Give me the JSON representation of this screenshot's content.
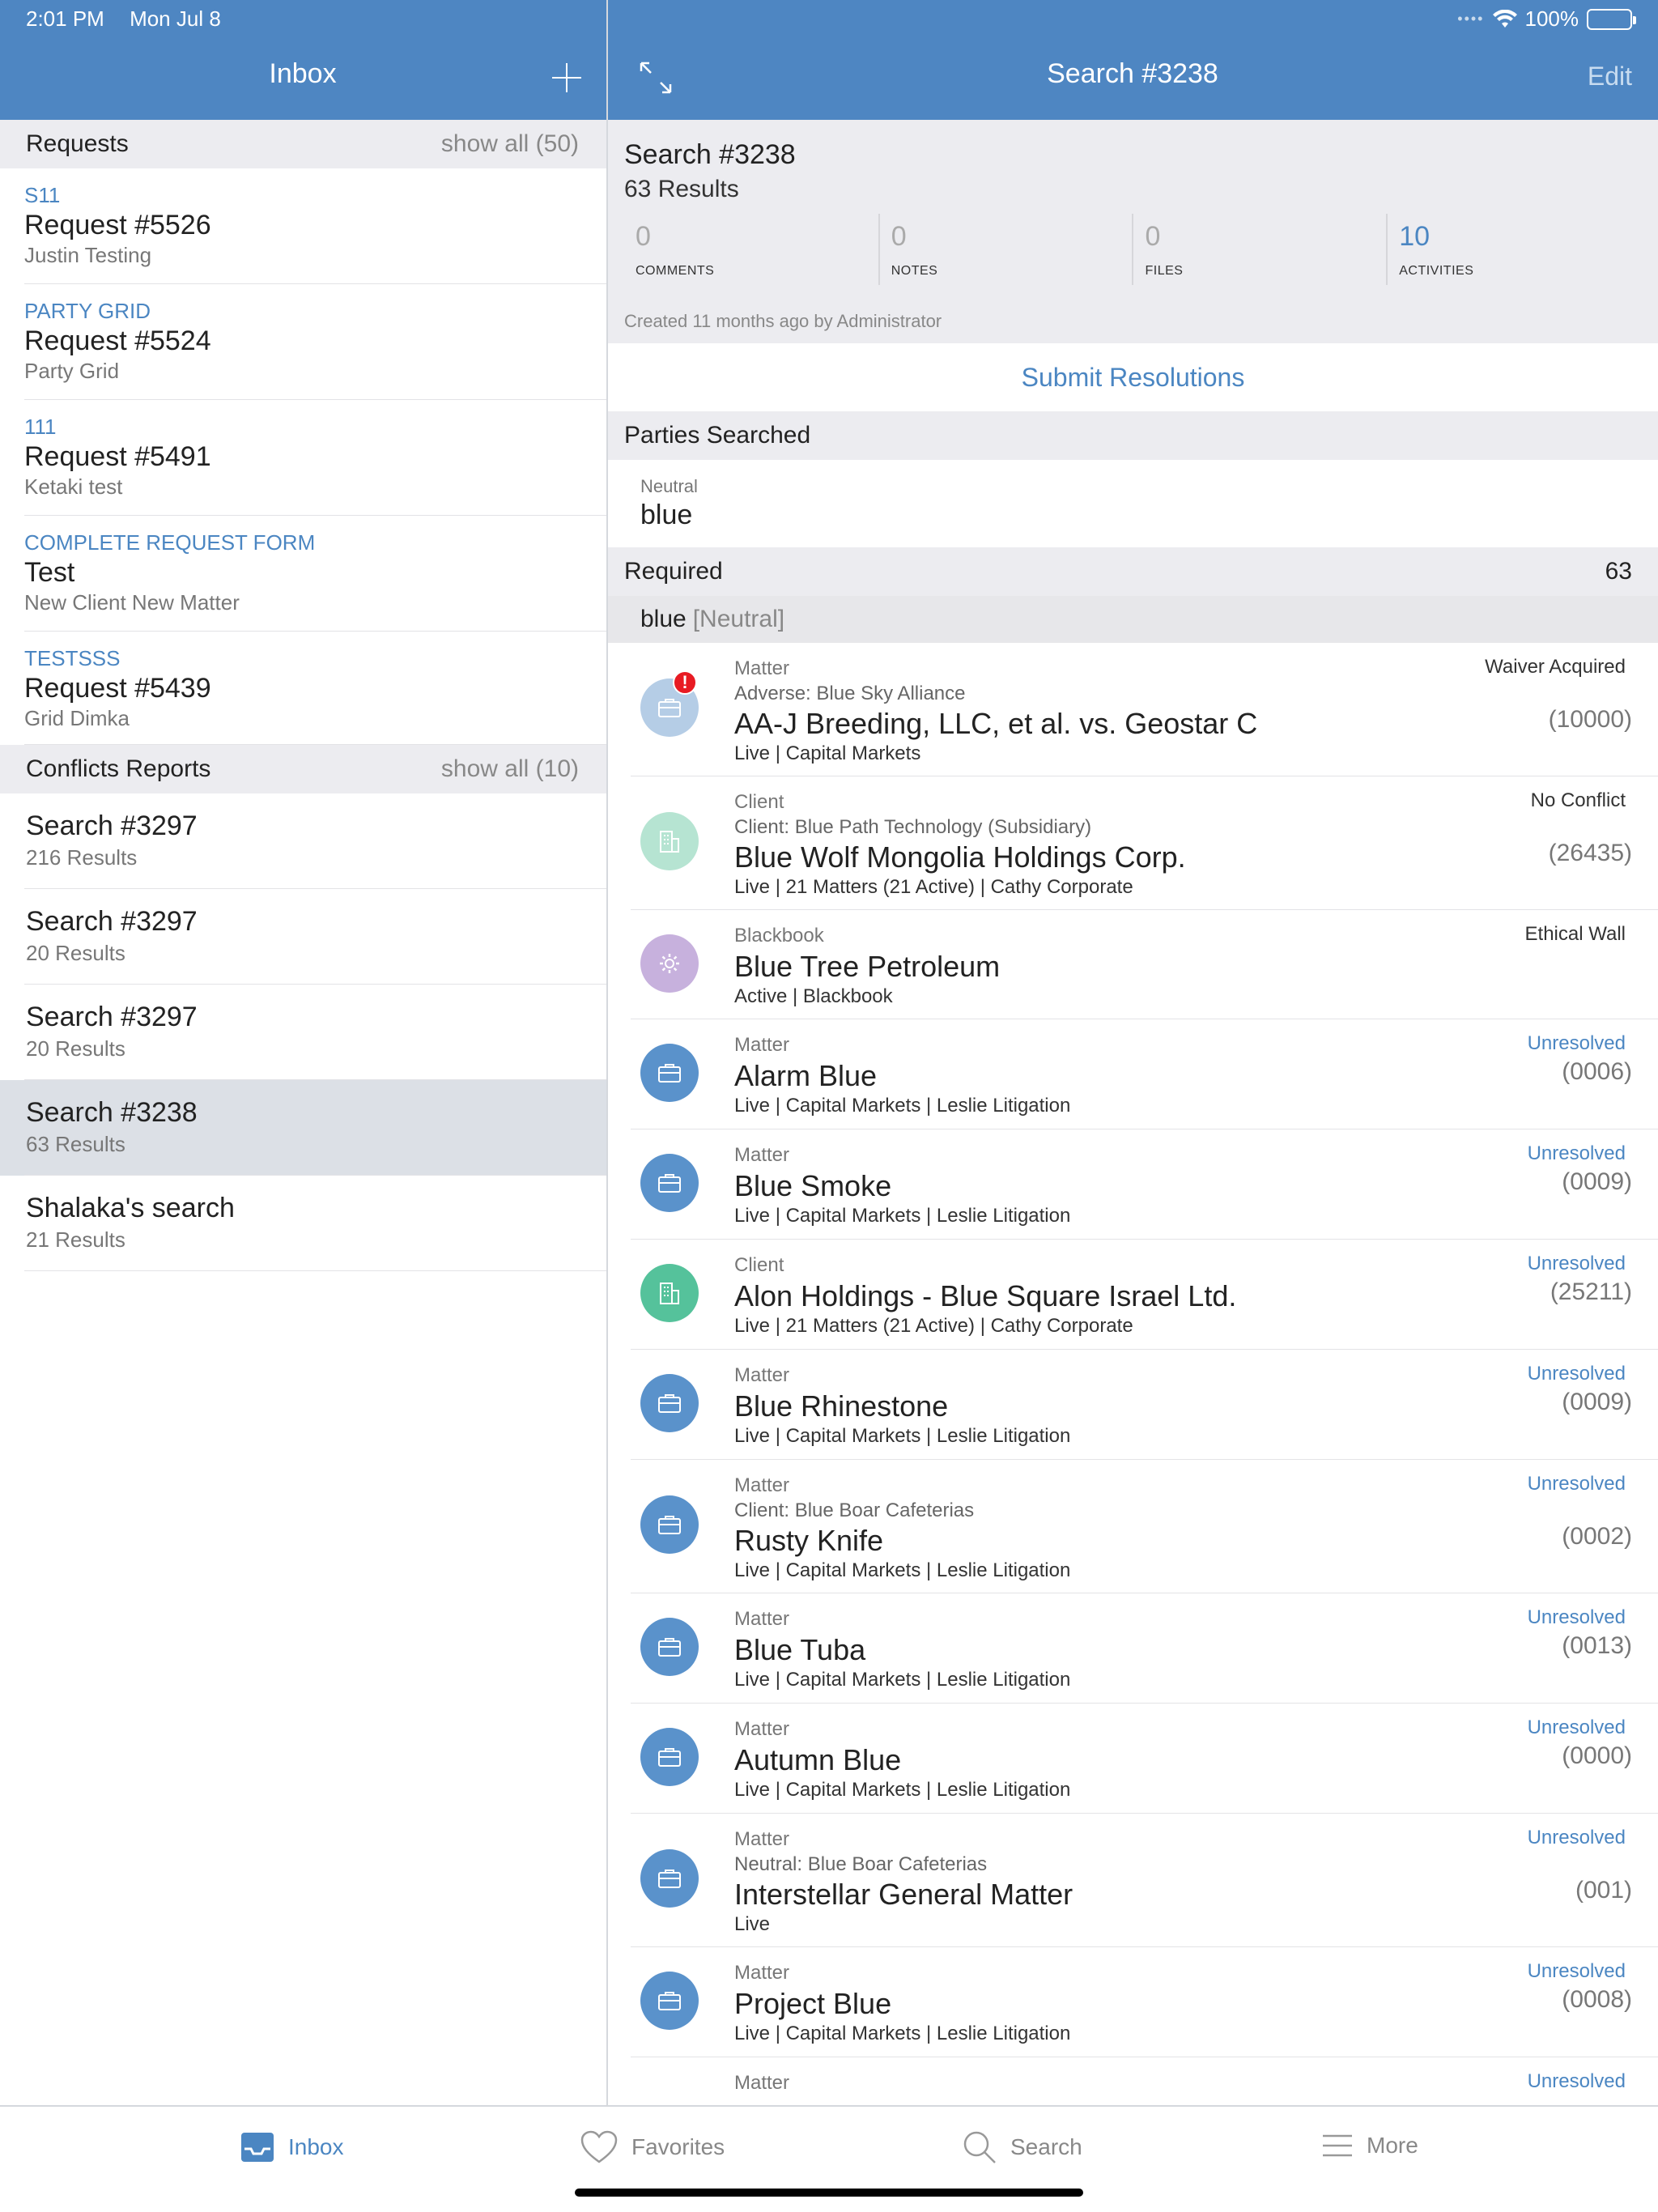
{
  "status": {
    "time": "2:01 PM",
    "date": "Mon Jul 8",
    "battery": "100%"
  },
  "left_header": {
    "title": "Inbox"
  },
  "right_header": {
    "title": "Search #3238",
    "edit": "Edit"
  },
  "requests": {
    "label": "Requests",
    "show_all": "show all (50)",
    "items": [
      {
        "tag": "S11",
        "title": "Request #5526",
        "sub": "Justin Testing"
      },
      {
        "tag": "PARTY GRID",
        "title": "Request #5524",
        "sub": "Party Grid"
      },
      {
        "tag": "111",
        "title": "Request #5491",
        "sub": "Ketaki test"
      },
      {
        "tag": "COMPLETE REQUEST FORM",
        "title": "Test",
        "sub": "New Client New Matter"
      },
      {
        "tag": "TESTSSS",
        "title": "Request #5439",
        "sub": "Grid Dimka"
      }
    ]
  },
  "reports": {
    "label": "Conflicts Reports",
    "show_all": "show all (10)",
    "items": [
      {
        "title": "Search #3297",
        "sub": "216 Results"
      },
      {
        "title": "Search #3297",
        "sub": "20 Results"
      },
      {
        "title": "Search #3297",
        "sub": "20 Results"
      },
      {
        "title": "Search #3238",
        "sub": "63 Results"
      },
      {
        "title": "Shalaka's search",
        "sub": "21 Results"
      }
    ]
  },
  "summary": {
    "title": "Search #3238",
    "results": "63 Results",
    "stats": [
      {
        "value": "0",
        "label": "COMMENTS"
      },
      {
        "value": "0",
        "label": "NOTES"
      },
      {
        "value": "0",
        "label": "FILES"
      },
      {
        "value": "10",
        "label": "ACTIVITIES"
      }
    ],
    "created": "Created 11 months ago by Administrator"
  },
  "submit_label": "Submit Resolutions",
  "parties": {
    "label": "Parties Searched",
    "role": "Neutral",
    "name": "blue"
  },
  "required": {
    "label": "Required",
    "count": "63",
    "group_name": "blue",
    "group_role": "[Neutral]"
  },
  "results": [
    {
      "type": "Matter",
      "sub": "Adverse: Blue Sky Alliance",
      "title": "AA-J Breeding, LLC, et al. vs. Geostar C",
      "meta": "Live | Capital Markets",
      "status": "Waiver Acquired",
      "number": "(10000)",
      "icon": "briefcase-icon"
    },
    {
      "type": "Client",
      "sub": "Client: Blue Path Technology (Subsidiary)",
      "title": "Blue Wolf Mongolia Holdings Corp.",
      "meta": "Live | 21 Matters (21 Active) | Cathy Corporate",
      "status": "No Conflict",
      "number": "(26435)",
      "icon": "building-icon"
    },
    {
      "type": "Blackbook",
      "sub": "",
      "title": "Blue Tree Petroleum",
      "meta": "Active | Blackbook",
      "status": "Ethical Wall",
      "number": "",
      "icon": "gear-icon"
    },
    {
      "type": "Matter",
      "sub": "",
      "title": "Alarm Blue",
      "meta": "Live | Capital Markets | Leslie Litigation",
      "status": "Unresolved",
      "number": "(0006)",
      "icon": "briefcase-icon"
    },
    {
      "type": "Matter",
      "sub": "",
      "title": "Blue Smoke",
      "meta": "Live | Capital Markets | Leslie Litigation",
      "status": "Unresolved",
      "number": "(0009)",
      "icon": "briefcase-icon"
    },
    {
      "type": "Client",
      "sub": "",
      "title": "Alon Holdings - Blue Square Israel Ltd.",
      "meta": "Live | 21 Matters (21 Active) | Cathy Corporate",
      "status": "Unresolved",
      "number": "(25211)",
      "icon": "building-icon"
    },
    {
      "type": "Matter",
      "sub": "",
      "title": "Blue Rhinestone",
      "meta": "Live | Capital Markets | Leslie Litigation",
      "status": "Unresolved",
      "number": "(0009)",
      "icon": "briefcase-icon"
    },
    {
      "type": "Matter",
      "sub": "Client: Blue Boar Cafeterias",
      "title": "Rusty Knife",
      "meta": "Live | Capital Markets | Leslie Litigation",
      "status": "Unresolved",
      "number": "(0002)",
      "icon": "briefcase-icon"
    },
    {
      "type": "Matter",
      "sub": "",
      "title": "Blue Tuba",
      "meta": "Live | Capital Markets | Leslie Litigation",
      "status": "Unresolved",
      "number": "(0013)",
      "icon": "briefcase-icon"
    },
    {
      "type": "Matter",
      "sub": "",
      "title": "Autumn Blue",
      "meta": "Live | Capital Markets | Leslie Litigation",
      "status": "Unresolved",
      "number": "(0000)",
      "icon": "briefcase-icon"
    },
    {
      "type": "Matter",
      "sub": "Neutral: Blue Boar Cafeterias",
      "title": "Interstellar General Matter",
      "meta": "Live",
      "status": "Unresolved",
      "number": "(001)",
      "icon": "briefcase-icon"
    },
    {
      "type": "Matter",
      "sub": "",
      "title": "Project Blue",
      "meta": "Live | Capital Markets | Leslie Litigation",
      "status": "Unresolved",
      "number": "(0008)",
      "icon": "briefcase-icon"
    },
    {
      "type": "Matter",
      "sub": "",
      "title": "",
      "meta": "",
      "status": "Unresolved",
      "number": "",
      "icon": ""
    }
  ],
  "tabs": [
    {
      "label": "Inbox",
      "icon": "inbox-icon"
    },
    {
      "label": "Favorites",
      "icon": "heart-icon"
    },
    {
      "label": "Search",
      "icon": "search-icon"
    },
    {
      "label": "More",
      "icon": "menu-icon"
    }
  ],
  "colors": {
    "header": "#4e86c2",
    "accent": "#4b86c2",
    "alert": "#e81b23"
  }
}
